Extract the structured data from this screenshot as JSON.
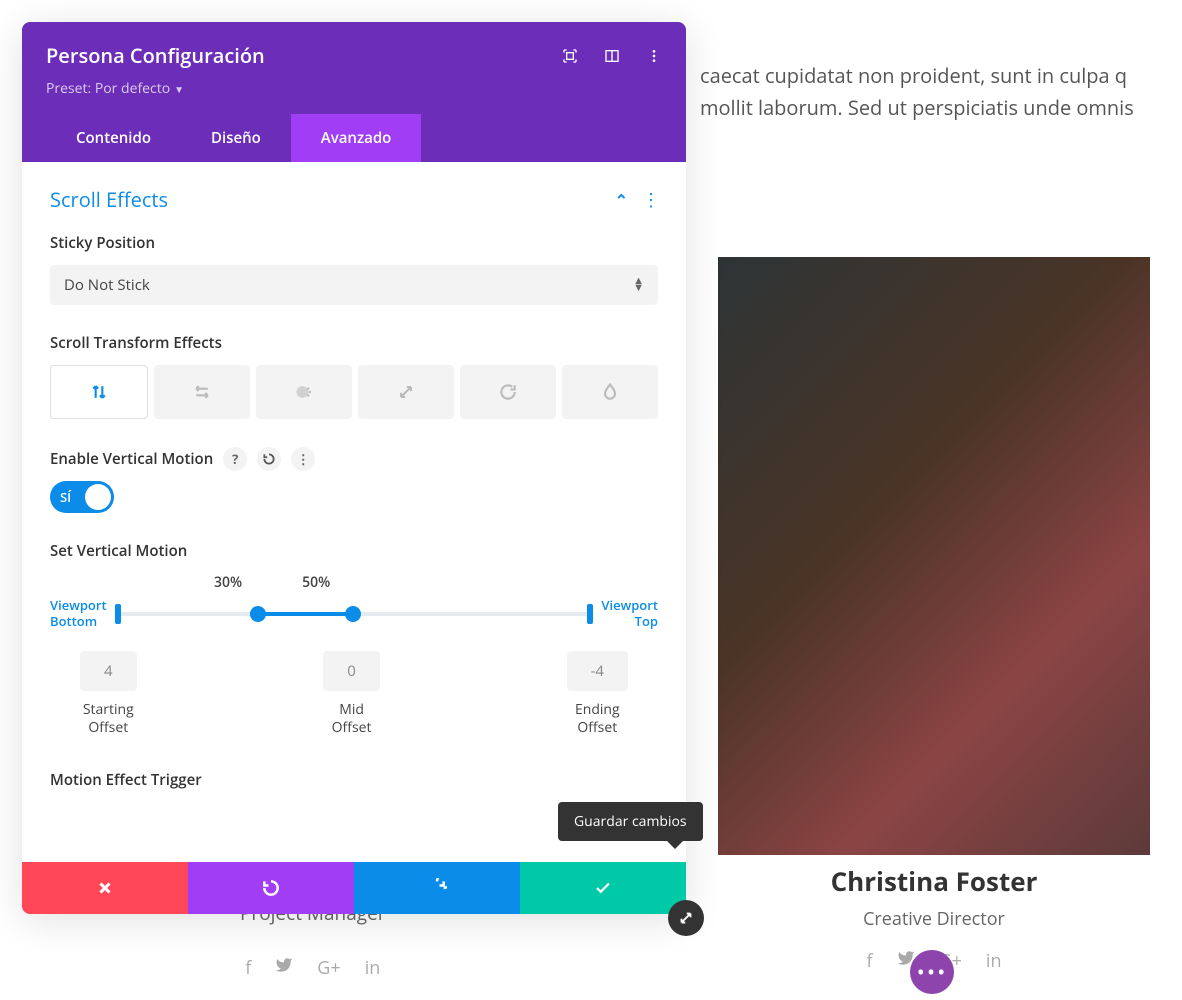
{
  "bg": {
    "text1": "caecat cupidatat non proident, sunt in culpa q",
    "text2": "mollit laborum. Sed ut perspiciatis unde omnis"
  },
  "person_right": {
    "name": "Christina Foster",
    "role": "Creative Director"
  },
  "person_left": {
    "role": "Project Manager"
  },
  "modal": {
    "title": "Persona Configuración",
    "preset_label": "Preset: Por defecto",
    "tabs": {
      "content": "Contenido",
      "design": "Diseño",
      "advanced": "Avanzado"
    },
    "section": "Scroll Effects",
    "sticky_label": "Sticky Position",
    "sticky_value": "Do Not Stick",
    "scroll_transform_label": "Scroll Transform Effects",
    "enable_vm_label": "Enable Vertical Motion",
    "toggle_on": "SÍ",
    "set_vm_label": "Set Vertical Motion",
    "pct_left": "30%",
    "pct_right": "50%",
    "vp_bottom": "Viewport Bottom",
    "vp_top": "Viewport Top",
    "offsets": {
      "start_val": "4",
      "start_lbl1": "Starting",
      "start_lbl2": "Offset",
      "mid_val": "0",
      "mid_lbl1": "Mid",
      "mid_lbl2": "Offset",
      "end_val": "-4",
      "end_lbl1": "Ending",
      "end_lbl2": "Offset"
    },
    "motion_trigger_label": "Motion Effect Trigger",
    "tooltip": "Guardar cambios"
  }
}
